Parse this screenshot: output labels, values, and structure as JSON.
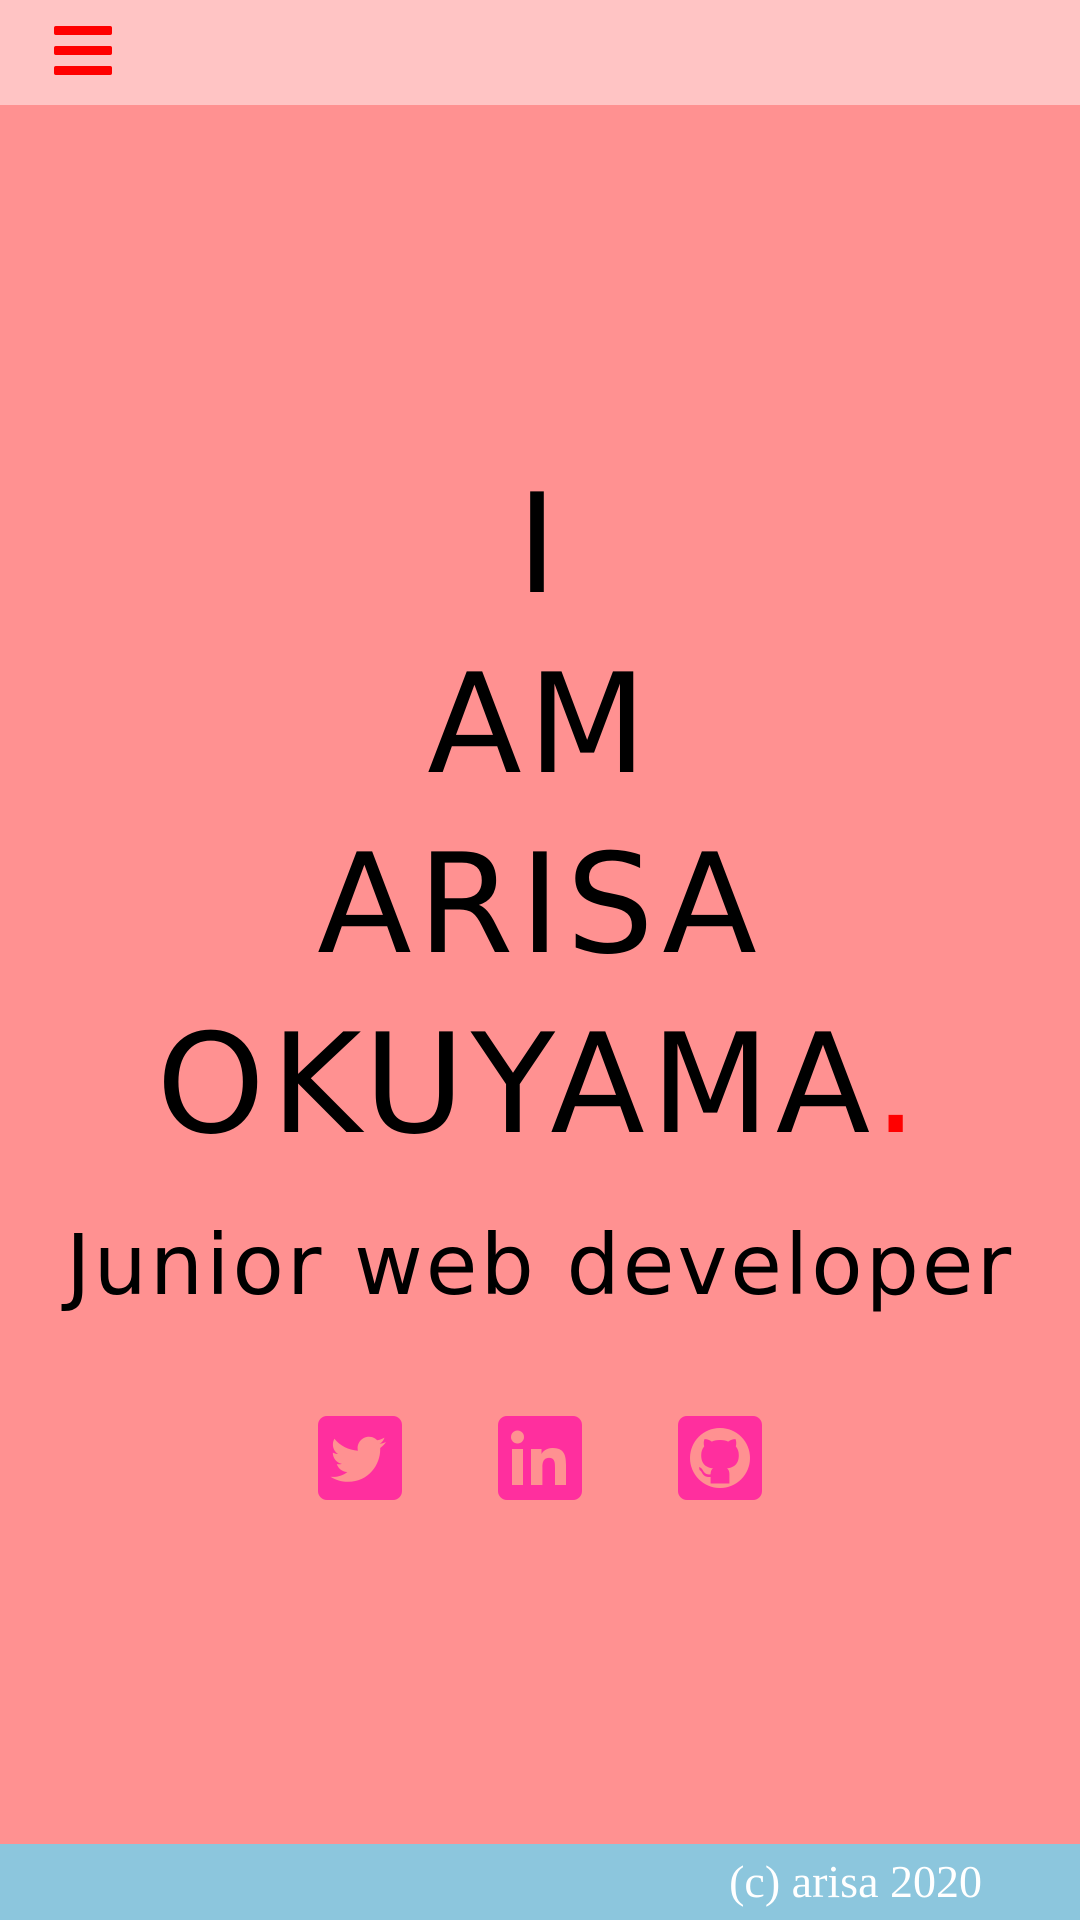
{
  "header": {
    "menu_icon": "hamburger-menu-icon",
    "menu_color": "#ff0000",
    "background": "#ffc4c4"
  },
  "hero": {
    "lines": [
      "I",
      "AM",
      "ARISA",
      "OKUYAMA"
    ],
    "accent_dot": ".",
    "accent_color": "#ff0000",
    "subtitle": "Junior web developer",
    "background": "#ff9191"
  },
  "social": {
    "color": "#ff2f9e",
    "items": [
      {
        "icon": "twitter-icon"
      },
      {
        "icon": "linkedin-icon"
      },
      {
        "icon": "github-icon"
      }
    ]
  },
  "footer": {
    "text": "(c) arisa 2020",
    "background": "#8cc6dd"
  }
}
